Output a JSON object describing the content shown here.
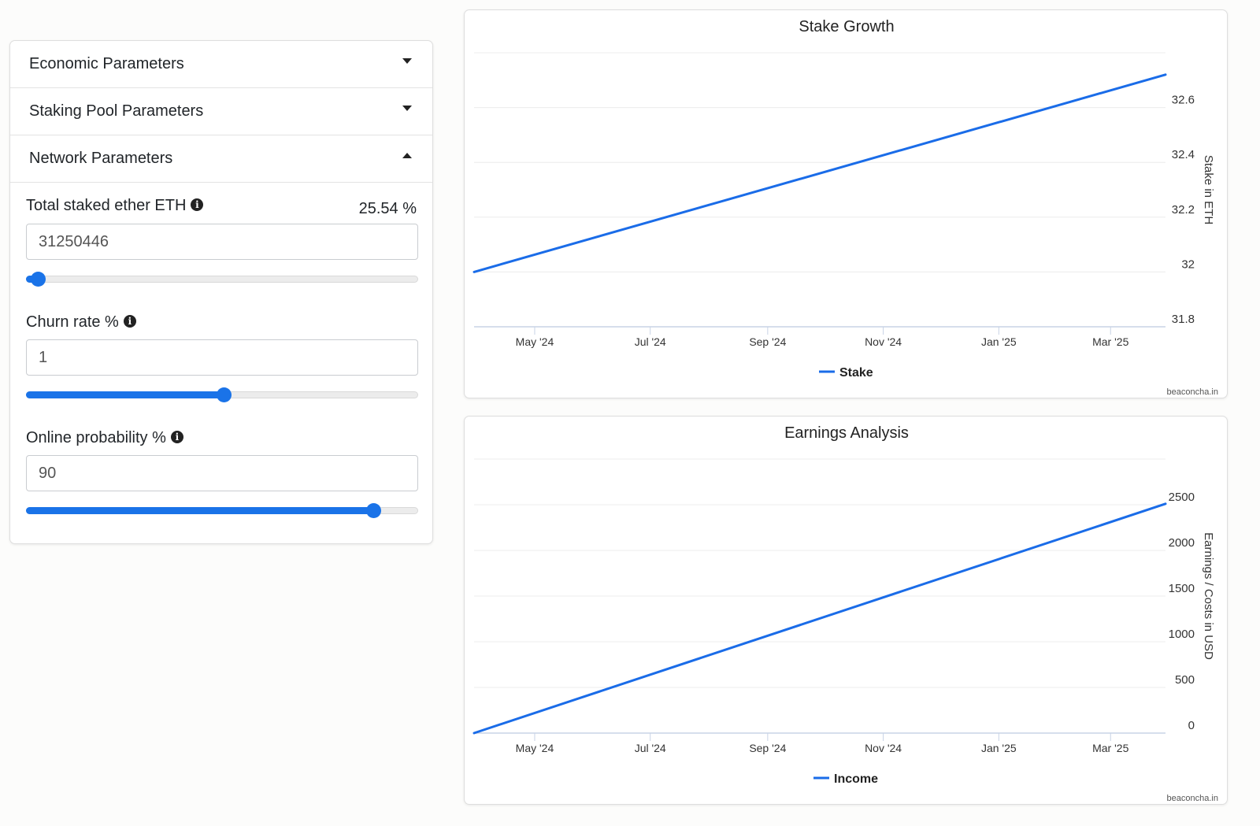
{
  "accordion": {
    "sections": [
      {
        "label": "Economic Parameters",
        "expanded": false
      },
      {
        "label": "Staking Pool Parameters",
        "expanded": false
      },
      {
        "label": "Network Parameters",
        "expanded": true
      }
    ],
    "network": {
      "total_staked": {
        "label": "Total staked ether ETH",
        "percent": "25.54 %",
        "value": "31250446",
        "slider_fraction": 0.03
      },
      "churn_rate": {
        "label": "Churn rate %",
        "value": "1",
        "slider_fraction": 0.505
      },
      "online_probability": {
        "label": "Online probability %",
        "value": "90",
        "slider_fraction": 0.885
      }
    }
  },
  "charts": {
    "credit": "beaconcha.in",
    "stake": {
      "title": "Stake Growth",
      "ylabel": "Stake in ETH",
      "legend": "Stake",
      "x_ticks": [
        "May '24",
        "Jul '24",
        "Sep '24",
        "Nov '24",
        "Jan '25",
        "Mar '25"
      ],
      "y_ticks": [
        "31.8",
        "32",
        "32.2",
        "32.4",
        "32.6"
      ]
    },
    "earnings": {
      "title": "Earnings Analysis",
      "ylabel": "Earnings / Costs in USD",
      "legend": "Income",
      "x_ticks": [
        "May '24",
        "Jul '24",
        "Sep '24",
        "Nov '24",
        "Jan '25",
        "Mar '25"
      ],
      "y_ticks": [
        "0",
        "500",
        "1000",
        "1500",
        "2000",
        "2500"
      ]
    }
  },
  "chart_data": [
    {
      "type": "line",
      "title": "Stake Growth",
      "ylabel": "Stake in ETH",
      "ylim": [
        31.8,
        32.8
      ],
      "x": [
        "2024-03-30",
        "2025-03-30"
      ],
      "series": [
        {
          "name": "Stake",
          "color": "#1a6ce8",
          "values": [
            32.0,
            32.72
          ]
        }
      ]
    },
    {
      "type": "line",
      "title": "Earnings Analysis",
      "ylabel": "Earnings / Costs in USD",
      "ylim": [
        0,
        3000
      ],
      "x": [
        "2024-03-30",
        "2025-03-30"
      ],
      "series": [
        {
          "name": "Income",
          "color": "#1a6ce8",
          "values": [
            0,
            2510
          ]
        }
      ]
    }
  ]
}
